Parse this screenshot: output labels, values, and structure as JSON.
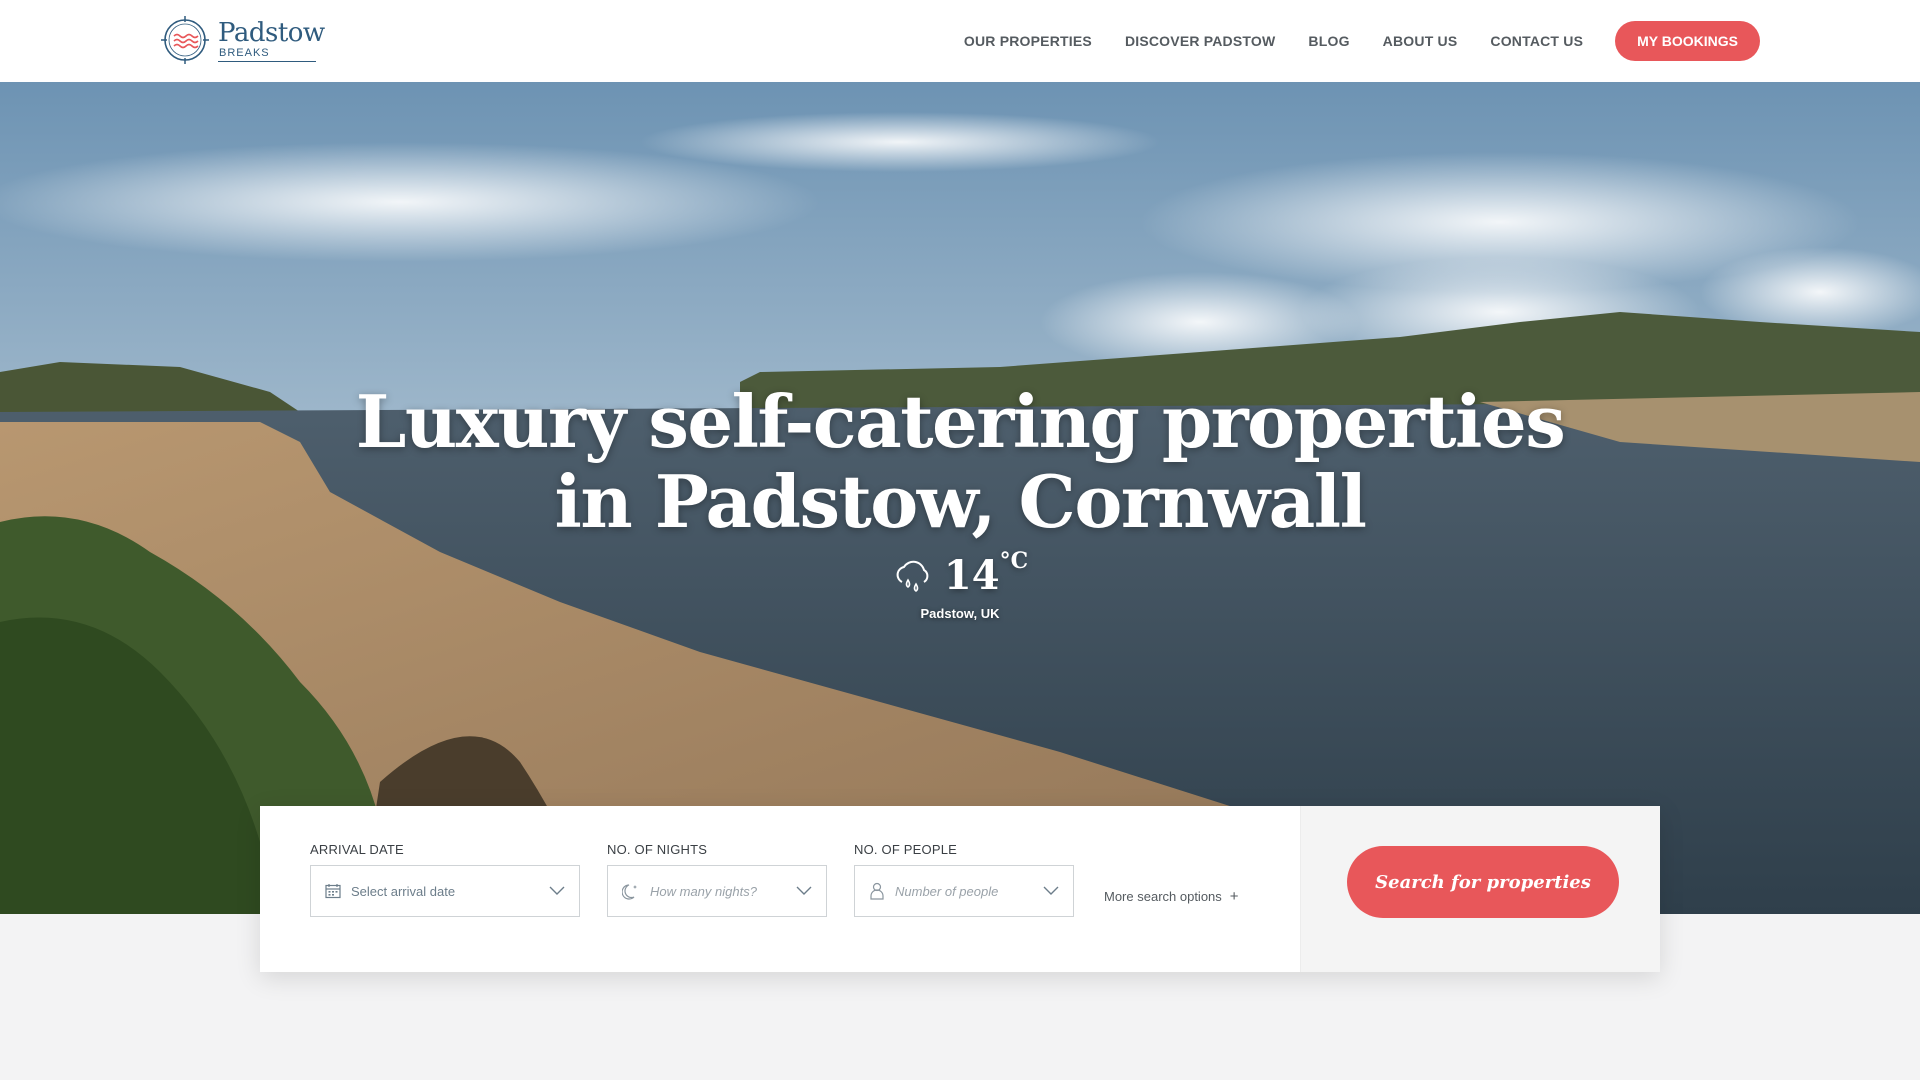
{
  "brand": {
    "name": "Padstow",
    "sub": "BREAKS",
    "accent": "#e8575a",
    "navy": "#2f5b7e"
  },
  "nav": {
    "links": [
      "OUR PROPERTIES",
      "DISCOVER PADSTOW",
      "BLOG",
      "ABOUT US",
      "CONTACT US"
    ],
    "cta": "MY BOOKINGS"
  },
  "hero": {
    "title_line1": "Luxury self-catering properties",
    "title_line2": "in Padstow, Cornwall",
    "weather": {
      "temp": "14",
      "unit": "°C",
      "location": "Padstow, UK",
      "icon": "rain-cloud-icon"
    }
  },
  "search": {
    "arrival": {
      "label": "ARRIVAL DATE",
      "placeholder": "Select arrival date",
      "icon": "calendar-icon"
    },
    "nights": {
      "label": "NO. OF NIGHTS",
      "placeholder": "How many nights?",
      "icon": "moon-icon"
    },
    "people": {
      "label": "NO. OF PEOPLE",
      "placeholder": "Number of people",
      "icon": "person-icon"
    },
    "more": "More search options",
    "more_icon": "+",
    "submit": "Search for properties"
  }
}
